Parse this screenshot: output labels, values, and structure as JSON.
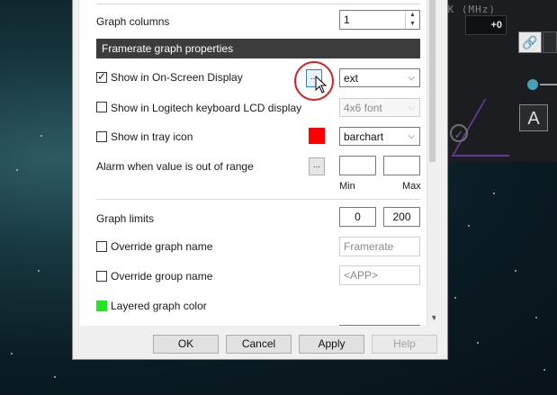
{
  "background_app": {
    "clock_header": "CK (MHz)",
    "offset_value": "+0",
    "link_icon": "link-icon",
    "a_button_label": "A",
    "check_icon": "check-circle-icon",
    "accent_color": "#7c3fb7"
  },
  "dialog": {
    "graph_columns": {
      "label": "Graph columns",
      "value": "1"
    },
    "section_title": "Framerate graph properties",
    "show_osd": {
      "label": "Show in On-Screen Display",
      "checked": true,
      "dots": "...",
      "select_value": "ext"
    },
    "show_lcd": {
      "label": "Show in Logitech keyboard LCD display",
      "checked": false,
      "select_value": "4x6 font"
    },
    "show_tray": {
      "label": "Show in tray icon",
      "checked": false,
      "color": "#ff0000",
      "select_value": "barchart"
    },
    "alarm": {
      "label": "Alarm when value is out of range",
      "dots": "...",
      "min_label": "Min",
      "max_label": "Max",
      "min_value": "",
      "max_value": ""
    },
    "graph_limits": {
      "label": "Graph limits",
      "min": "0",
      "max": "200"
    },
    "override_graph_name": {
      "label": "Override graph name",
      "checked": false,
      "value": "Framerate"
    },
    "override_group_name": {
      "label": "Override group name",
      "checked": false,
      "value": "<APP>"
    },
    "layered_color": {
      "label": "Layered graph color",
      "color": "#22e622"
    }
  },
  "buttons": {
    "ok": "OK",
    "cancel": "Cancel",
    "apply": "Apply",
    "help": "Help"
  }
}
